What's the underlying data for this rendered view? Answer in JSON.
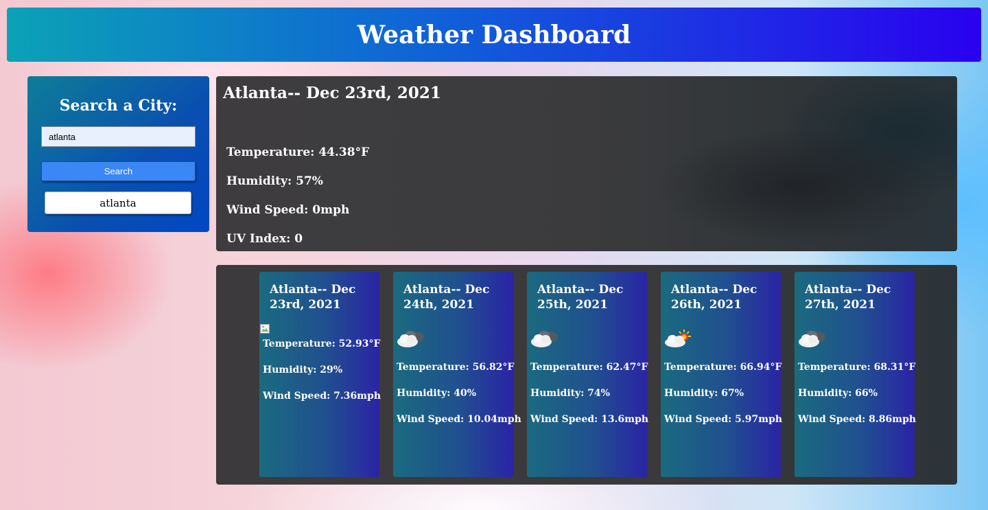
{
  "header": {
    "title": "Weather Dashboard"
  },
  "search": {
    "title": "Search a City:",
    "input_value": "atlanta",
    "button_label": "Search",
    "history": [
      "atlanta"
    ]
  },
  "current": {
    "title": "Atlanta-- Dec 23rd, 2021",
    "temperature": "Temperature: 44.38°F",
    "humidity": "Humidity: 57%",
    "wind": "Wind Speed: 0mph",
    "uv": "UV Index: 0"
  },
  "forecast": [
    {
      "title": "Atlanta-- Dec 23rd, 2021",
      "icon": "broken-image-icon",
      "temperature": "Temperature: 52.93°F",
      "humidity": "Humidity: 29%",
      "wind": "Wind Speed: 7.36mph"
    },
    {
      "title": "Atlanta-- Dec 24th, 2021",
      "icon": "cloudy-night-icon",
      "temperature": "Temperature: 56.82°F",
      "humidity": "Humidity: 40%",
      "wind": "Wind Speed: 10.04mph"
    },
    {
      "title": "Atlanta-- Dec 25th, 2021",
      "icon": "cloudy-night-icon",
      "temperature": "Temperature: 62.47°F",
      "humidity": "Humidity: 74%",
      "wind": "Wind Speed: 13.6mph"
    },
    {
      "title": "Atlanta-- Dec 26th, 2021",
      "icon": "partly-cloudy-day-icon",
      "temperature": "Temperature: 66.94°F",
      "humidity": "Humidity: 67%",
      "wind": "Wind Speed: 5.97mph"
    },
    {
      "title": "Atlanta-- Dec 27th, 2021",
      "icon": "cloudy-night-icon",
      "temperature": "Temperature: 68.31°F",
      "humidity": "Humidity: 66%",
      "wind": "Wind Speed: 8.86mph"
    }
  ]
}
